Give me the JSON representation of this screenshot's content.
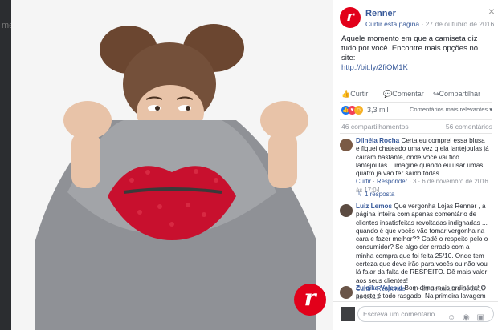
{
  "background": {
    "edge_text": "me"
  },
  "photo": {
    "logo_letter": "r",
    "brand_color": "#e2001a"
  },
  "post": {
    "page_name": "Renner",
    "like_page": "Curtir esta página",
    "date": "27 de outubro de 2016",
    "text": "Aquele momento em que a camiseta diz tudo por você. Encontre mais opções no site:",
    "link": "http://bit.ly/2fiOM1K",
    "logo_letter": "r"
  },
  "actions": {
    "like": "Curtir",
    "comment": "Comentar",
    "share": "Compartilhar"
  },
  "reactions": {
    "count": "3,3 mil",
    "sort": "Comentários mais relevantes ▾"
  },
  "stats": {
    "shares": "46 compartilhamentos",
    "comments": "56 comentários"
  },
  "comments": [
    {
      "name": "Dilnéia Rocha",
      "text": "Certa eu comprei essa blusa e fiquei chateado uma vez q ela lantejoulas já caíram bastante, onde você vai fico lantejoulas... imagine quando eu usar umas quatro já vão ter saído todas",
      "like": "Curtir",
      "reply": "Responder",
      "info": "3 · 6 de novembro de 2016 às 17:04",
      "replies": "1 resposta"
    },
    {
      "name": "Luiz Lemos",
      "text": "Que vergonha Lojas Renner , a página inteira com apenas comentário de clientes insatisfeitas revoltadas indignadas ... quando é que vocês vão tomar vergonha na cara e fazer melhor?? Cadê o respeito pelo o consumidor? Se algo der errado com a minha compra que foi feita 25/10. Onde tem certeza que deve irão para vocês ou não vou lá falar da falta de RESPEITO. Dê mais valor aos seus clientes!",
      "like": "Curtir",
      "reply": "Responder",
      "info": "1 · 29 de outubro de 2016 às 16:13"
    },
    {
      "name": "Zuleika Valeski",
      "text": "Bom dima mais ordinária! O pacote é todo rasgado. Na primeira lavagem vai perder os",
      "like": "",
      "reply": "",
      "info": ""
    }
  ],
  "composer": {
    "placeholder": "Escreva um comentário...",
    "icons": "☺ ◉ ▣"
  },
  "close": "×"
}
